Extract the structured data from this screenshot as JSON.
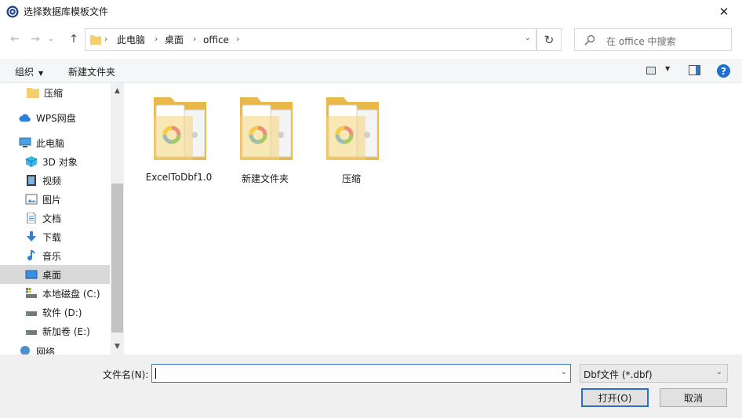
{
  "window": {
    "title": "选择数据库模板文件",
    "close": "✕"
  },
  "nav": {
    "back": "←",
    "forward": "→",
    "recent": "⌄",
    "up": "↑"
  },
  "address": {
    "crumbs": [
      "此电脑",
      "桌面",
      "office"
    ],
    "separator": "›",
    "dropdown": "⌄",
    "refresh": "↻"
  },
  "search": {
    "placeholder": "在 office 中搜索",
    "icon": "search-icon"
  },
  "toolbar": {
    "organize": "组织",
    "organize_arrow": "▼",
    "new_folder": "新建文件夹",
    "view_arrow": "▼",
    "help": "?"
  },
  "sidebar": {
    "items": [
      {
        "label": "压缩",
        "icon": "folder-icon"
      },
      {
        "label": "WPS网盘",
        "icon": "cloud-icon"
      },
      {
        "label": "此电脑",
        "icon": "computer-icon"
      },
      {
        "label": "3D 对象",
        "icon": "3d-objects-icon"
      },
      {
        "label": "视频",
        "icon": "video-icon"
      },
      {
        "label": "图片",
        "icon": "pictures-icon"
      },
      {
        "label": "文档",
        "icon": "documents-icon"
      },
      {
        "label": "下载",
        "icon": "download-icon"
      },
      {
        "label": "音乐",
        "icon": "music-icon"
      },
      {
        "label": "桌面",
        "icon": "desktop-icon",
        "selected": true
      },
      {
        "label": "本地磁盘 (C:)",
        "icon": "drive-c-icon"
      },
      {
        "label": "软件 (D:)",
        "icon": "drive-icon"
      },
      {
        "label": "新加卷 (E:)",
        "icon": "drive-icon"
      },
      {
        "label": "网络",
        "icon": "network-icon"
      }
    ],
    "scroll_up": "▲",
    "scroll_down": "▼"
  },
  "files": [
    {
      "name": "ExcelToDbf1.0"
    },
    {
      "name": "新建文件夹"
    },
    {
      "name": "压缩"
    }
  ],
  "bottom": {
    "filename_label": "文件名(N):",
    "filename_value": "",
    "filename_dropdown": "⌄",
    "filter": "Dbf文件 (*.dbf)",
    "filter_dropdown": "⌄",
    "open_button": "打开(O)",
    "cancel_button": "取消"
  },
  "colors": {
    "accent": "#2c6ec8",
    "folder": "#f5cf6b",
    "selected_bg": "#d9d9d9"
  }
}
